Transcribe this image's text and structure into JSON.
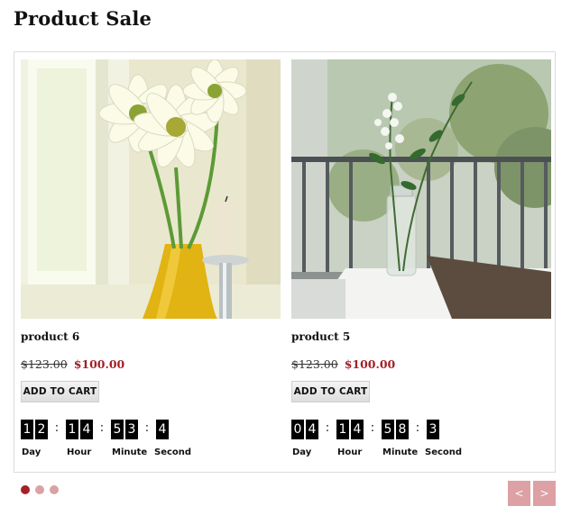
{
  "heading": "Product Sale",
  "colors": {
    "accent": "#a32127",
    "nav_button": "#dda0a4",
    "inactive_dot": "#dca1a3"
  },
  "products": [
    {
      "name": "product 6",
      "old_price": "$123.00",
      "new_price": "$100.00",
      "cart_label": "ADD TO CART",
      "image": "daisies-in-yellow-vase-icon",
      "countdown": {
        "day": [
          "1",
          "2"
        ],
        "hour": [
          "1",
          "4"
        ],
        "minute": [
          "5",
          "3"
        ],
        "second": [
          "4"
        ]
      }
    },
    {
      "name": "product 5",
      "old_price": "$123.00",
      "new_price": "$100.00",
      "cart_label": "ADD TO CART",
      "image": "flowers-in-glass-jar-icon",
      "countdown": {
        "day": [
          "0",
          "4"
        ],
        "hour": [
          "1",
          "4"
        ],
        "minute": [
          "5",
          "8"
        ],
        "second": [
          "3"
        ]
      }
    }
  ],
  "unit_labels": {
    "day": "Day",
    "hour": "Hour",
    "minute": "Minute",
    "second": "Second"
  },
  "separator": ":",
  "pagination": {
    "count": 3,
    "active_index": 0
  },
  "nav": {
    "prev": "<",
    "next": ">"
  }
}
